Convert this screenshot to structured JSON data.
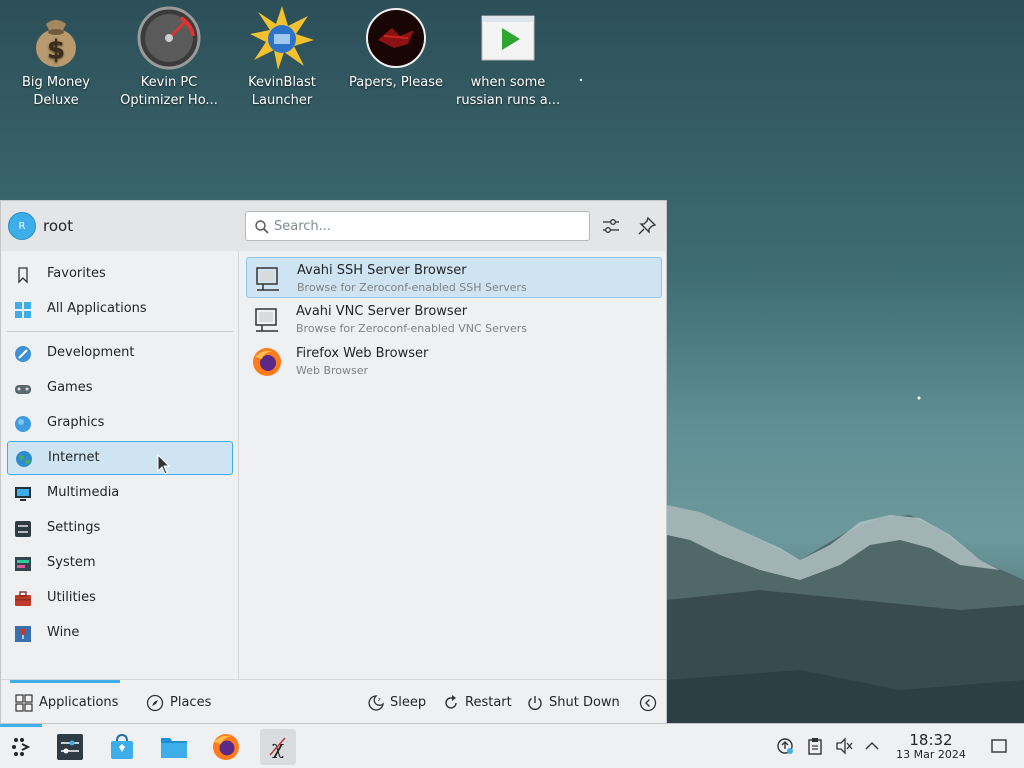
{
  "desktop": {
    "icons": [
      {
        "label1": "Big Money",
        "label2": "Deluxe",
        "icon": "money-bag-icon"
      },
      {
        "label1": "Kevin PC",
        "label2": "Optimizer Ho...",
        "icon": "gauge-icon"
      },
      {
        "label1": "KevinBlast",
        "label2": "Launcher",
        "icon": "starburst-icon"
      },
      {
        "label1": "Papers, Please",
        "label2": "",
        "icon": "papers-please-icon"
      },
      {
        "label1": "when some",
        "label2": "russian runs a...",
        "icon": "video-play-icon"
      }
    ]
  },
  "launcher": {
    "user": {
      "initial": "R",
      "name": "root"
    },
    "search": {
      "placeholder": "Search..."
    },
    "sidebar": {
      "top_items": [
        {
          "label": "Favorites",
          "icon": "bookmark-icon"
        },
        {
          "label": "All Applications",
          "icon": "grid-icon"
        }
      ],
      "categories": [
        {
          "label": "Development",
          "icon": "development-icon"
        },
        {
          "label": "Games",
          "icon": "gamepad-icon"
        },
        {
          "label": "Graphics",
          "icon": "graphics-icon"
        },
        {
          "label": "Internet",
          "icon": "globe-icon",
          "active": true
        },
        {
          "label": "Multimedia",
          "icon": "multimedia-icon"
        },
        {
          "label": "Settings",
          "icon": "settings-icon"
        },
        {
          "label": "System",
          "icon": "system-icon"
        },
        {
          "label": "Utilities",
          "icon": "toolbox-icon"
        },
        {
          "label": "Wine",
          "icon": "wine-icon"
        }
      ]
    },
    "apps": [
      {
        "name": "Avahi SSH Server Browser",
        "desc": "Browse for Zeroconf-enabled SSH Servers",
        "icon": "network-server-icon",
        "active": true
      },
      {
        "name": "Avahi VNC Server Browser",
        "desc": "Browse for Zeroconf-enabled VNC Servers",
        "icon": "network-server-icon"
      },
      {
        "name": "Firefox Web Browser",
        "desc": "Web Browser",
        "icon": "firefox-icon"
      }
    ],
    "tabs": {
      "applications": "Applications",
      "places": "Places"
    },
    "power": {
      "sleep": "Sleep",
      "restart": "Restart",
      "shutdown": "Shut Down"
    }
  },
  "taskbar": {
    "clock": {
      "time": "18:32",
      "date": "13 Mar 2024"
    }
  },
  "colors": {
    "accent": "#3daee9",
    "highlight": "#cfe4f2",
    "panel": "#eff0f1"
  }
}
